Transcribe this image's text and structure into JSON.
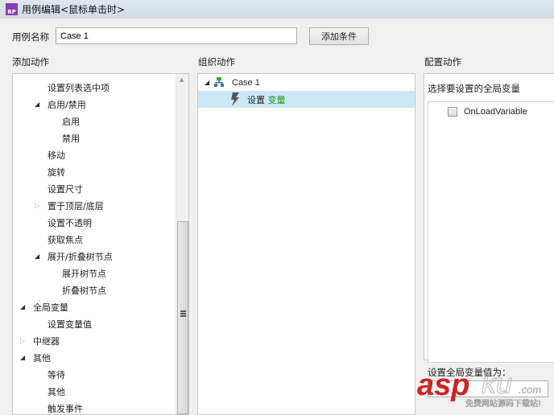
{
  "window": {
    "title": "用例编辑<鼠标单击时>",
    "logo": "RP"
  },
  "case_name": {
    "label": "用例名称",
    "value": "Case 1"
  },
  "add_condition_label": "添加条件",
  "columns": {
    "add": "添加动作",
    "organize": "组织动作",
    "configure": "配置动作"
  },
  "actions": [
    {
      "label": "设置列表选中项",
      "level": 2,
      "arrow": ""
    },
    {
      "label": "启用/禁用",
      "level": 2,
      "arrow": "open"
    },
    {
      "label": "启用",
      "level": 3,
      "arrow": ""
    },
    {
      "label": "禁用",
      "level": 3,
      "arrow": ""
    },
    {
      "label": "移动",
      "level": 2,
      "arrow": ""
    },
    {
      "label": "旋转",
      "level": 2,
      "arrow": ""
    },
    {
      "label": "设置尺寸",
      "level": 2,
      "arrow": ""
    },
    {
      "label": "置于顶层/底层",
      "level": 2,
      "arrow": "closed"
    },
    {
      "label": "设置不透明",
      "level": 2,
      "arrow": ""
    },
    {
      "label": "获取焦点",
      "level": 2,
      "arrow": ""
    },
    {
      "label": "展开/折叠树节点",
      "level": 2,
      "arrow": "open"
    },
    {
      "label": "展开树节点",
      "level": 3,
      "arrow": ""
    },
    {
      "label": "折叠树节点",
      "level": 3,
      "arrow": ""
    },
    {
      "label": "全局变量",
      "level": 1,
      "arrow": "open"
    },
    {
      "label": "设置变量值",
      "level": 2,
      "arrow": ""
    },
    {
      "label": "中继器",
      "level": 1,
      "arrow": "closed"
    },
    {
      "label": "其他",
      "level": 1,
      "arrow": "open"
    },
    {
      "label": "等待",
      "level": 2,
      "arrow": ""
    },
    {
      "label": "其他",
      "level": 2,
      "arrow": ""
    },
    {
      "label": "触发事件",
      "level": 2,
      "arrow": ""
    }
  ],
  "organize": {
    "case_label": "Case 1",
    "action_prefix": "设置",
    "action_target": "变量",
    "action_target_color": "#1a9a1a"
  },
  "configure": {
    "select_label": "选择要设置的全局变量",
    "variables": [
      {
        "name": "OnLoadVariable",
        "checked": false
      }
    ],
    "value_label": "设置全局变量值为："
  },
  "watermark": {
    "brand": "aspku.com",
    "slogan": "免费网站源码下载站!"
  },
  "colors": {
    "selection": "#cce8f6",
    "accent": "#8a3cb4"
  }
}
